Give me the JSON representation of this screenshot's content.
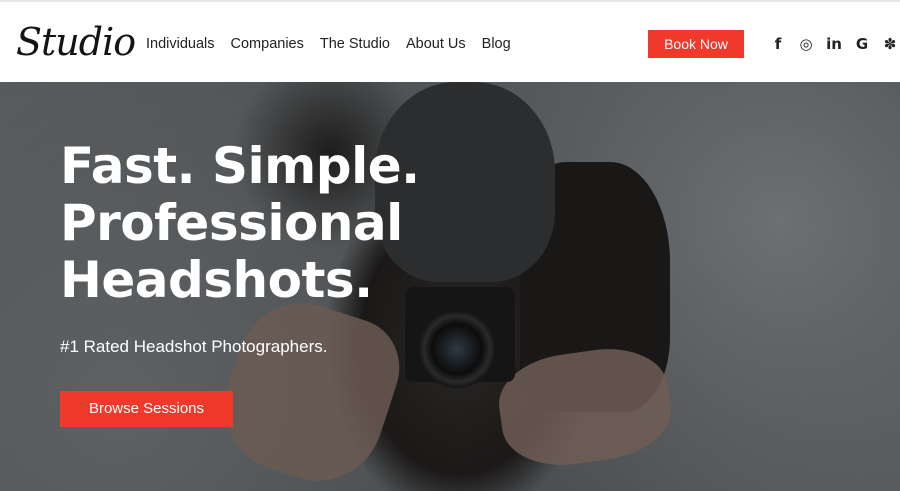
{
  "header": {
    "logo": "Studio",
    "nav": [
      "Individuals",
      "Companies",
      "The Studio",
      "About Us",
      "Blog"
    ],
    "book_label": "Book Now",
    "socials": [
      {
        "icon": "facebook-icon",
        "glyph": "f"
      },
      {
        "icon": "instagram-icon",
        "glyph": "◎"
      },
      {
        "icon": "linkedin-icon",
        "glyph": "in"
      },
      {
        "icon": "google-icon",
        "glyph": "G"
      },
      {
        "icon": "yelp-icon",
        "glyph": "✽"
      }
    ]
  },
  "hero": {
    "headline": [
      "Fast. Simple.",
      "Professional",
      "Headshots."
    ],
    "subheadline": "#1 Rated Headshot Photographers.",
    "cta_label": "Browse Sessions"
  },
  "colors": {
    "accent": "#f0382b",
    "text_dark": "#222222",
    "hero_text": "#ffffff"
  }
}
